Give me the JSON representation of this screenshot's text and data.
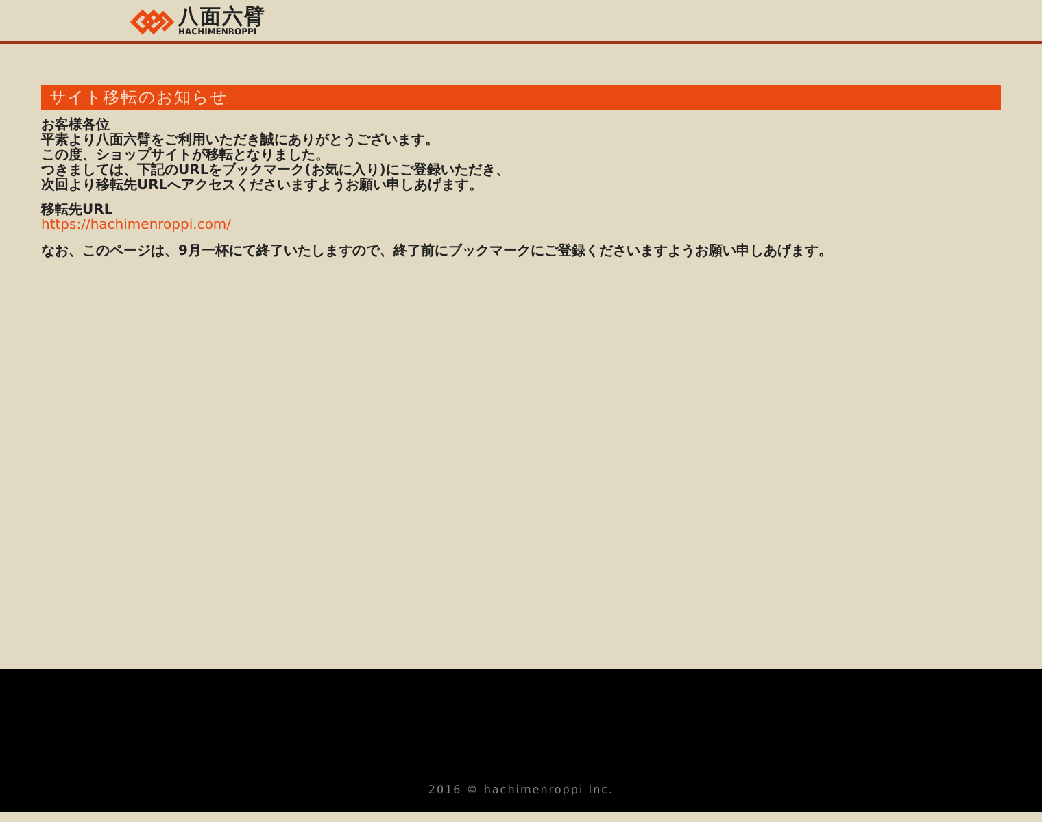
{
  "header": {
    "logo_name": "八面六臂",
    "logo_romaji": "HACHIMENROPPI"
  },
  "notice": {
    "title": "サイト移転のお知らせ",
    "greeting": "お客様各位",
    "body": [
      "平素より八面六臂をご利用いただき誠にありがとうございます。",
      "この度、ショップサイトが移転となりました。",
      "つきましては、下記のURLをブックマーク(お気に入り)にご登録いただき、",
      "次回より移転先URLへアクセスくださいますようお願い申しあげます。"
    ],
    "url_label": "移転先URL",
    "url": "https://hachimenroppi.com/",
    "closing": "なお、このページは、9月一杯にて終了いたしますので、終了前にブックマークにご登録くださいますようお願い申しあげます。"
  },
  "footer": {
    "copyright": "2016 © hachimenroppi Inc."
  }
}
